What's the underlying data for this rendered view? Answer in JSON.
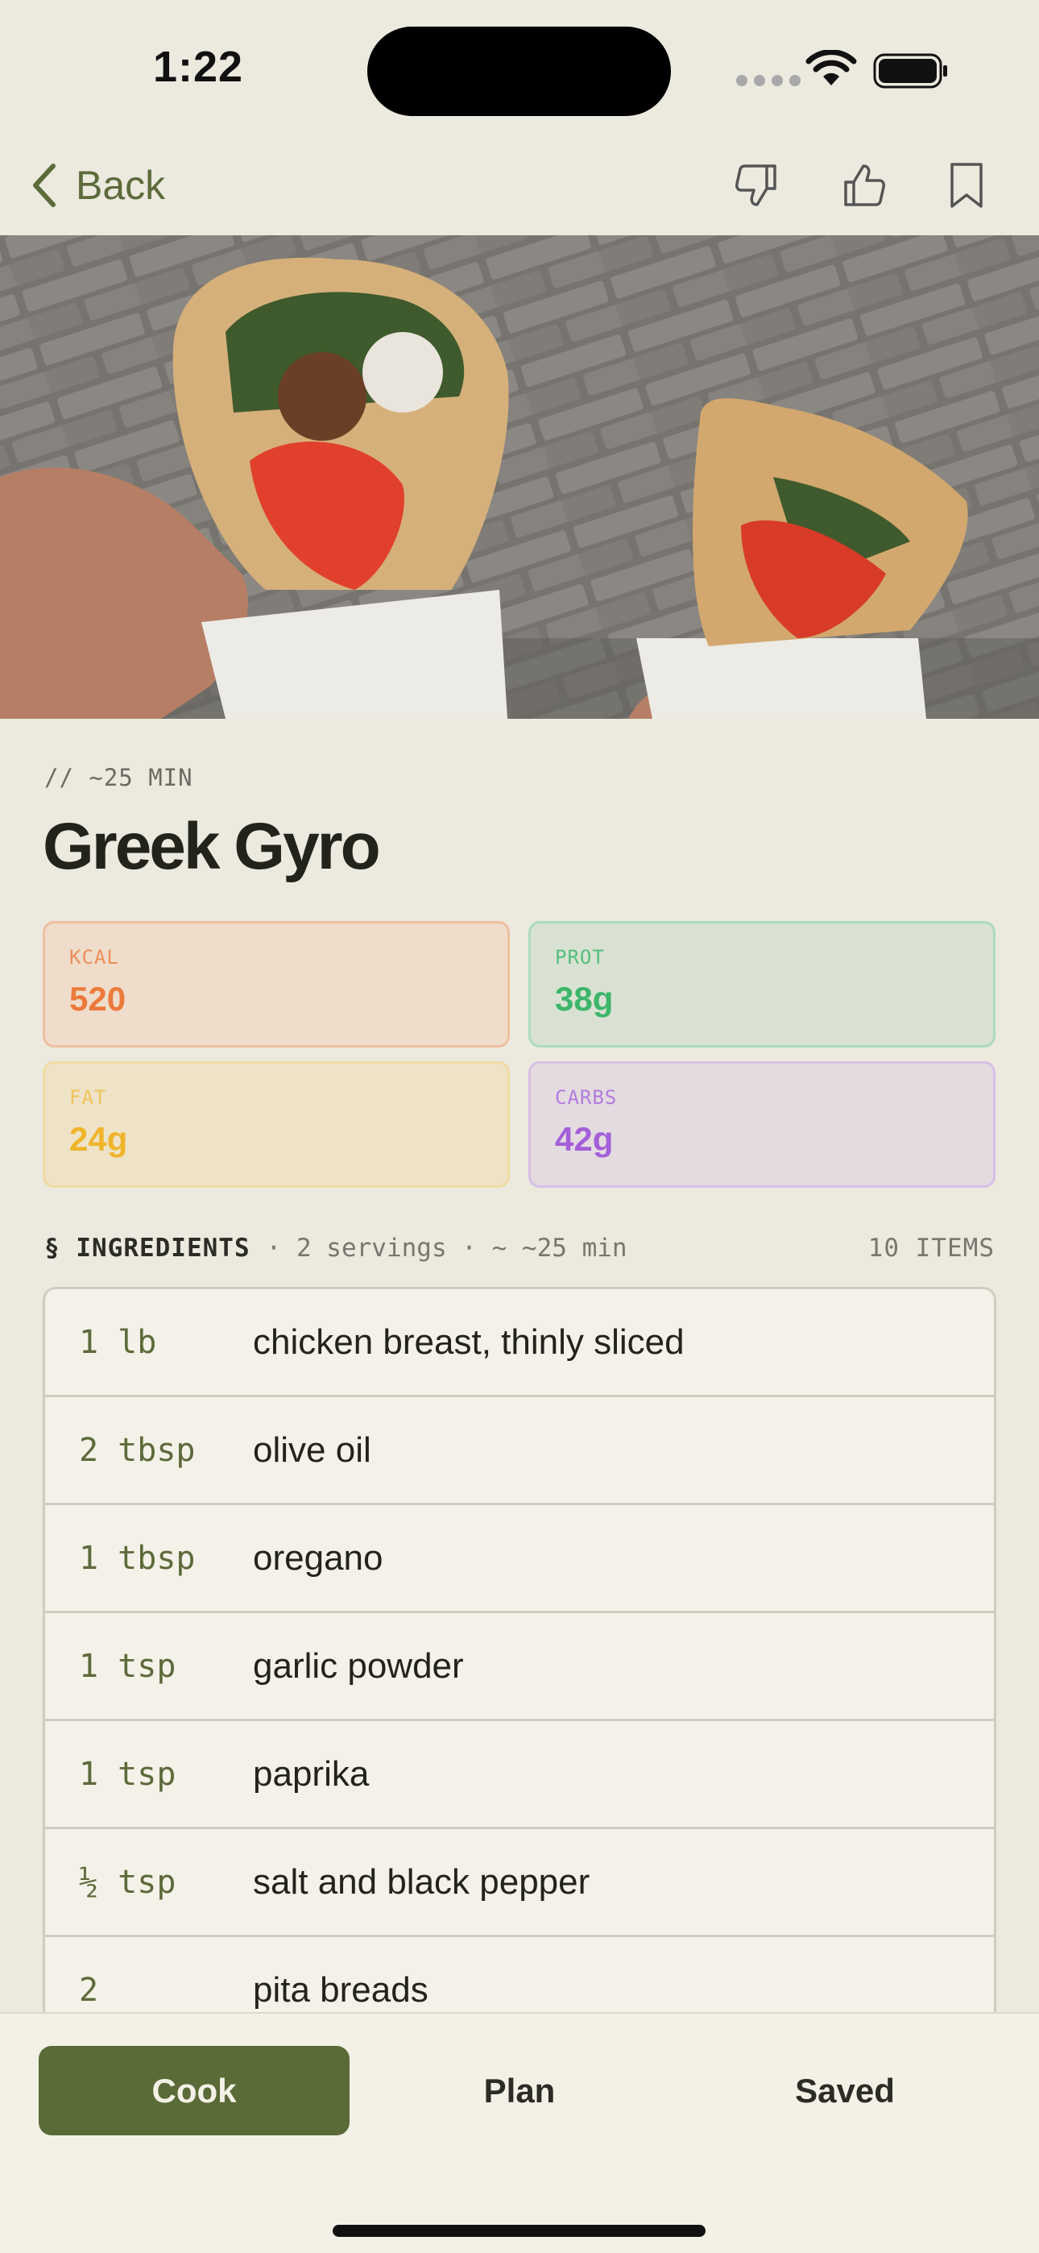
{
  "status_bar": {
    "time": "1:22",
    "icons": [
      "signal-icon",
      "wifi-icon",
      "battery-icon"
    ]
  },
  "nav": {
    "back_label": "Back",
    "actions": [
      "thumbs-down-icon",
      "thumbs-up-icon",
      "bookmark-icon"
    ]
  },
  "hero": {
    "icon": "gyro-photo"
  },
  "recipe": {
    "time_tag": "// ~25 MIN",
    "title": "Greek Gyro"
  },
  "macros": {
    "kcal": {
      "label": "KCAL",
      "value": "520"
    },
    "prot": {
      "label": "PROT",
      "value": "38g"
    },
    "fat": {
      "label": "FAT",
      "value": "24g"
    },
    "carbs": {
      "label": "CARBS",
      "value": "42g"
    }
  },
  "ingredients": {
    "title": "§ INGREDIENTS",
    "meta": "· 2 servings · ~ ~25 min",
    "count": "10 ITEMS",
    "items": [
      {
        "qty": "1 lb",
        "name": "chicken breast, thinly sliced"
      },
      {
        "qty": "2 tbsp",
        "name": "olive oil"
      },
      {
        "qty": "1 tbsp",
        "name": "oregano"
      },
      {
        "qty": "1 tsp",
        "name": "garlic powder"
      },
      {
        "qty": "1 tsp",
        "name": "paprika"
      },
      {
        "qty": "½ tsp",
        "name": "salt and black pepper"
      },
      {
        "qty": "2",
        "name": "pita breads"
      }
    ]
  },
  "tabs": {
    "cook": "Cook",
    "plan": "Plan",
    "saved": "Saved",
    "active": "cook"
  },
  "colors": {
    "accent": "#5a6b38",
    "background": "#ece9df",
    "kcal": "#ec7a3a",
    "prot": "#3db56b",
    "fat": "#efb42a",
    "carbs": "#a45fd9"
  }
}
